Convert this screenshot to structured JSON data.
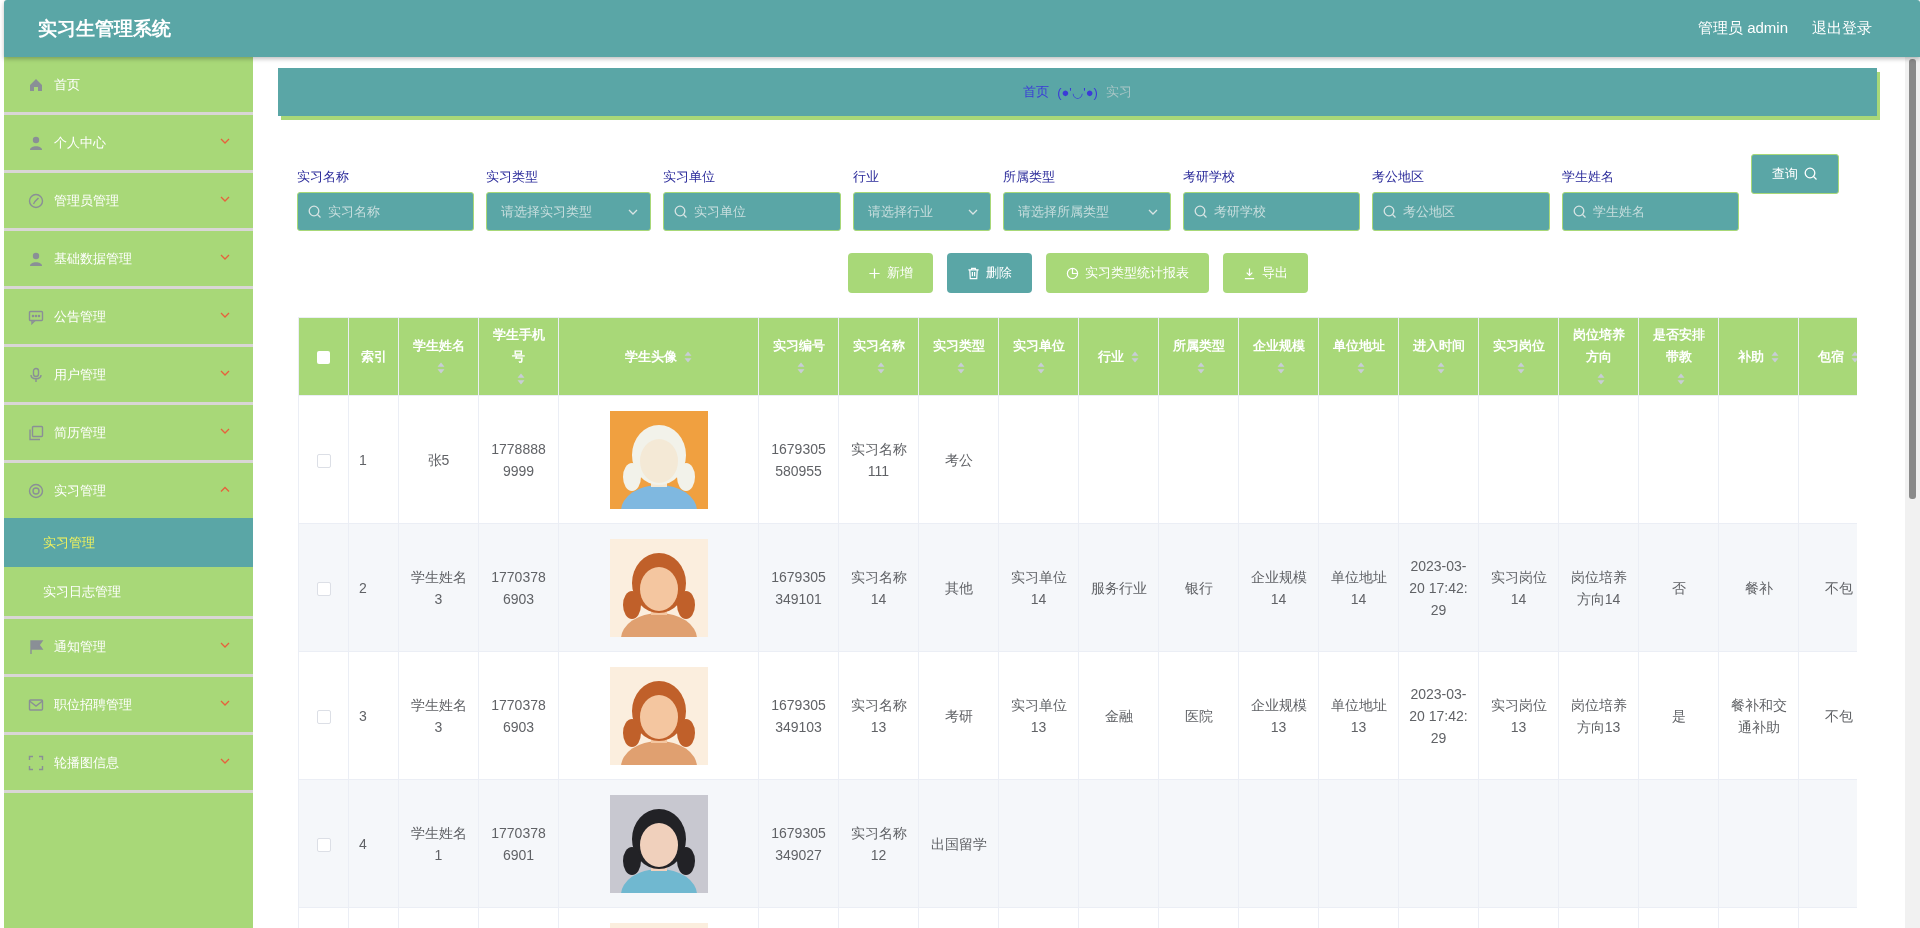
{
  "header": {
    "title": "实习生管理系统",
    "user": "管理员 admin",
    "logout": "退出登录"
  },
  "sidebar": {
    "items": [
      {
        "label": "首页"
      },
      {
        "label": "个人中心",
        "expanded": false
      },
      {
        "label": "管理员管理",
        "expanded": false
      },
      {
        "label": "基础数据管理",
        "expanded": false
      },
      {
        "label": "公告管理",
        "expanded": false
      },
      {
        "label": "用户管理",
        "expanded": false
      },
      {
        "label": "简历管理",
        "expanded": false
      },
      {
        "label": "实习管理",
        "expanded": true,
        "children": [
          {
            "label": "实习管理",
            "selected": true
          },
          {
            "label": "实习日志管理",
            "selected": false
          }
        ]
      },
      {
        "label": "通知管理",
        "expanded": false
      },
      {
        "label": "职位招聘管理",
        "expanded": false
      },
      {
        "label": "轮播图信息",
        "expanded": false
      }
    ]
  },
  "breadcrumb": [
    "首页",
    "(●'◡'●)",
    "实习"
  ],
  "filters": [
    {
      "label": "实习名称",
      "kind": "text",
      "placeholder": "实习名称"
    },
    {
      "label": "实习类型",
      "kind": "select",
      "placeholder": "请选择实习类型"
    },
    {
      "label": "实习单位",
      "kind": "text",
      "placeholder": "实习单位"
    },
    {
      "label": "行业",
      "kind": "select",
      "placeholder": "请选择行业"
    },
    {
      "label": "所属类型",
      "kind": "select",
      "placeholder": "请选择所属类型"
    },
    {
      "label": "考研学校",
      "kind": "text",
      "placeholder": "考研学校"
    },
    {
      "label": "考公地区",
      "kind": "text",
      "placeholder": "考公地区"
    },
    {
      "label": "学生姓名",
      "kind": "text",
      "placeholder": "学生姓名"
    }
  ],
  "search_button": "查询",
  "actions": [
    {
      "label": "新增",
      "kind": "add"
    },
    {
      "label": "删除",
      "kind": "delete"
    },
    {
      "label": "实习类型统计报表",
      "kind": "report"
    },
    {
      "label": "导出",
      "kind": "export"
    }
  ],
  "table": {
    "select_all": {
      "checked": false
    },
    "columns": [
      {
        "label": "索引",
        "sortable": false
      },
      {
        "label": "学生姓名",
        "sortable": true
      },
      {
        "label": "学生手机号",
        "sortable": true
      },
      {
        "label": "学生头像",
        "sortable": true
      },
      {
        "label": "实习编号",
        "sortable": true
      },
      {
        "label": "实习名称",
        "sortable": true
      },
      {
        "label": "实习类型",
        "sortable": true
      },
      {
        "label": "实习单位",
        "sortable": true
      },
      {
        "label": "行业",
        "sortable": true
      },
      {
        "label": "所属类型",
        "sortable": true
      },
      {
        "label": "企业规模",
        "sortable": true
      },
      {
        "label": "单位地址",
        "sortable": true
      },
      {
        "label": "进入时间",
        "sortable": true
      },
      {
        "label": "实习岗位",
        "sortable": true
      },
      {
        "label": "岗位培养方向",
        "sortable": true
      },
      {
        "label": "是否安排带教",
        "sortable": true
      },
      {
        "label": "补助",
        "sortable": true
      },
      {
        "label": "包宿",
        "sortable": true
      }
    ],
    "rows": [
      {
        "checked": false,
        "cells": [
          "1",
          "张5",
          "17788889999",
          {
            "kind": "picture"
          },
          "1679305580955",
          "实习名称111",
          "考公",
          null,
          null,
          null,
          null,
          null,
          null,
          null,
          null,
          null,
          null,
          null
        ]
      },
      {
        "checked": false,
        "cells": [
          "2",
          "学生姓名3",
          "17703786903",
          {
            "kind": "picture"
          },
          "1679305349101",
          "实习名称14",
          "其他",
          "实习单位14",
          "服务行业",
          "银行",
          "企业规模14",
          "单位地址14",
          "2023-03-20 17:42:29",
          "实习岗位14",
          "岗位培养方向14",
          "否",
          "餐补",
          "不包"
        ]
      },
      {
        "checked": false,
        "cells": [
          "3",
          "学生姓名3",
          "17703786903",
          {
            "kind": "picture"
          },
          "1679305349103",
          "实习名称13",
          "考研",
          "实习单位13",
          "金融",
          "医院",
          "企业规模13",
          "单位地址13",
          "2023-03-20 17:42:29",
          "实习岗位13",
          "岗位培养方向13",
          "是",
          "餐补和交通补助",
          "不包"
        ]
      },
      {
        "checked": false,
        "cells": [
          "4",
          "学生姓名1",
          "17703786901",
          {
            "kind": "picture"
          },
          "1679305349027",
          "实习名称12",
          "出国留学",
          null,
          null,
          null,
          null,
          null,
          null,
          null,
          null,
          null,
          null,
          null
        ]
      },
      {
        "cells": [
          null,
          null,
          null,
          {
            "kind": "picture"
          },
          null,
          null,
          null,
          null,
          null,
          null,
          null,
          null,
          null,
          null,
          null,
          null,
          null,
          null
        ]
      }
    ]
  }
}
